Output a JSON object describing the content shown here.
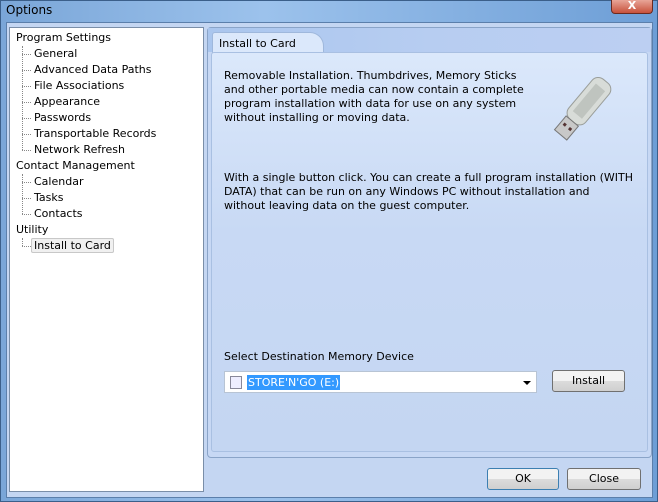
{
  "window": {
    "title": "Options",
    "close_glyph": "X"
  },
  "tree": {
    "groups": [
      {
        "label": "Program Settings",
        "children": [
          "General",
          "Advanced Data Paths",
          "File Associations",
          "Appearance",
          "Passwords",
          "Transportable Records",
          "Network Refresh"
        ]
      },
      {
        "label": "Contact Management",
        "children": [
          "Calendar",
          "Tasks",
          "Contacts"
        ]
      },
      {
        "label": "Utility",
        "children": [
          "Install to Card"
        ]
      }
    ],
    "selected": "Install to Card"
  },
  "panel": {
    "tab": "Install to Card",
    "description1": "Removable Installation.  Thumbdrives, Memory Sticks and other portable media can now contain a complete program installation with data for use on any system without installing or moving data.",
    "description2": "With a single button click.  You can create a full program installation (WITH DATA) that can be run on any Windows PC without installation and without leaving data on the guest computer.",
    "device_label": "Select Destination Memory Device",
    "device_value": "STORE'N'GO (E:)",
    "install_label": "Install",
    "image_icon": "usb-drive-icon"
  },
  "footer": {
    "ok": "OK",
    "close": "Close"
  }
}
